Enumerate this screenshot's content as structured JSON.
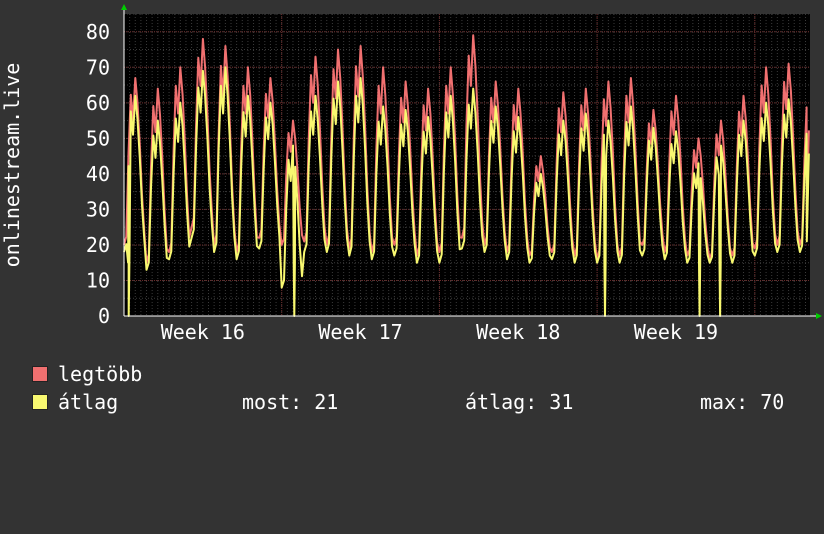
{
  "chart_data": {
    "type": "line",
    "ylabel": "onlinestream.live",
    "ylim": [
      0,
      85
    ],
    "yticks": [
      0,
      10,
      20,
      30,
      40,
      50,
      60,
      70,
      80
    ],
    "x_tick_labels": [
      "Week 16",
      "Week 17",
      "Week 18",
      "Week 19"
    ],
    "x_tick_positions_weeks": [
      0.5,
      1.5,
      2.5,
      3.5
    ],
    "x_range_weeks": [
      0,
      4.35
    ],
    "grid": true,
    "series": [
      {
        "name": "legtöbb",
        "color": "#f07070",
        "daily_peaks": [
          67,
          64,
          70,
          78,
          76,
          70,
          67,
          55,
          73,
          75,
          76,
          70,
          66,
          64,
          70,
          79,
          66,
          64,
          45,
          63,
          64,
          66,
          67,
          58,
          62,
          50,
          55,
          62,
          70,
          71,
          63,
          71,
          69,
          63,
          47,
          60,
          58,
          60,
          51,
          60
        ],
        "daily_troughs": [
          20,
          15,
          18,
          25,
          20,
          18,
          22,
          20,
          21,
          20,
          19,
          18,
          20,
          17,
          18,
          22,
          20,
          18,
          17,
          18,
          17,
          16,
          17,
          20,
          18,
          17,
          16,
          17,
          19,
          20,
          20,
          18,
          17,
          15,
          15,
          14,
          16,
          17,
          16,
          21
        ],
        "last_value": 25
      },
      {
        "name": "átlag",
        "color": "#f8f870",
        "daily_peaks": [
          62,
          55,
          60,
          69,
          70,
          62,
          60,
          48,
          62,
          66,
          67,
          59,
          58,
          56,
          62,
          64,
          59,
          56,
          40,
          55,
          57,
          55,
          59,
          53,
          52,
          43,
          48,
          55,
          60,
          61,
          55,
          62,
          60,
          56,
          40,
          52,
          51,
          52,
          46,
          52
        ],
        "daily_troughs": [
          18,
          13,
          16,
          22,
          18,
          16,
          19,
          8,
          18,
          18,
          17,
          16,
          17,
          15,
          15,
          19,
          18,
          16,
          15,
          16,
          15,
          15,
          15,
          17,
          16,
          15,
          15,
          15,
          17,
          18,
          18,
          0,
          15,
          13,
          13,
          13,
          14,
          15,
          14,
          16
        ],
        "dropouts_weeks": [
          0.03,
          1.08,
          3.05,
          3.65,
          3.78
        ],
        "last_value": 21
      }
    ]
  },
  "legend": {
    "max_label": "legtöbb",
    "avg_label": "átlag",
    "now_text": "most: 21",
    "avg_text": "átlag: 31",
    "peak_text": "max: 70"
  }
}
